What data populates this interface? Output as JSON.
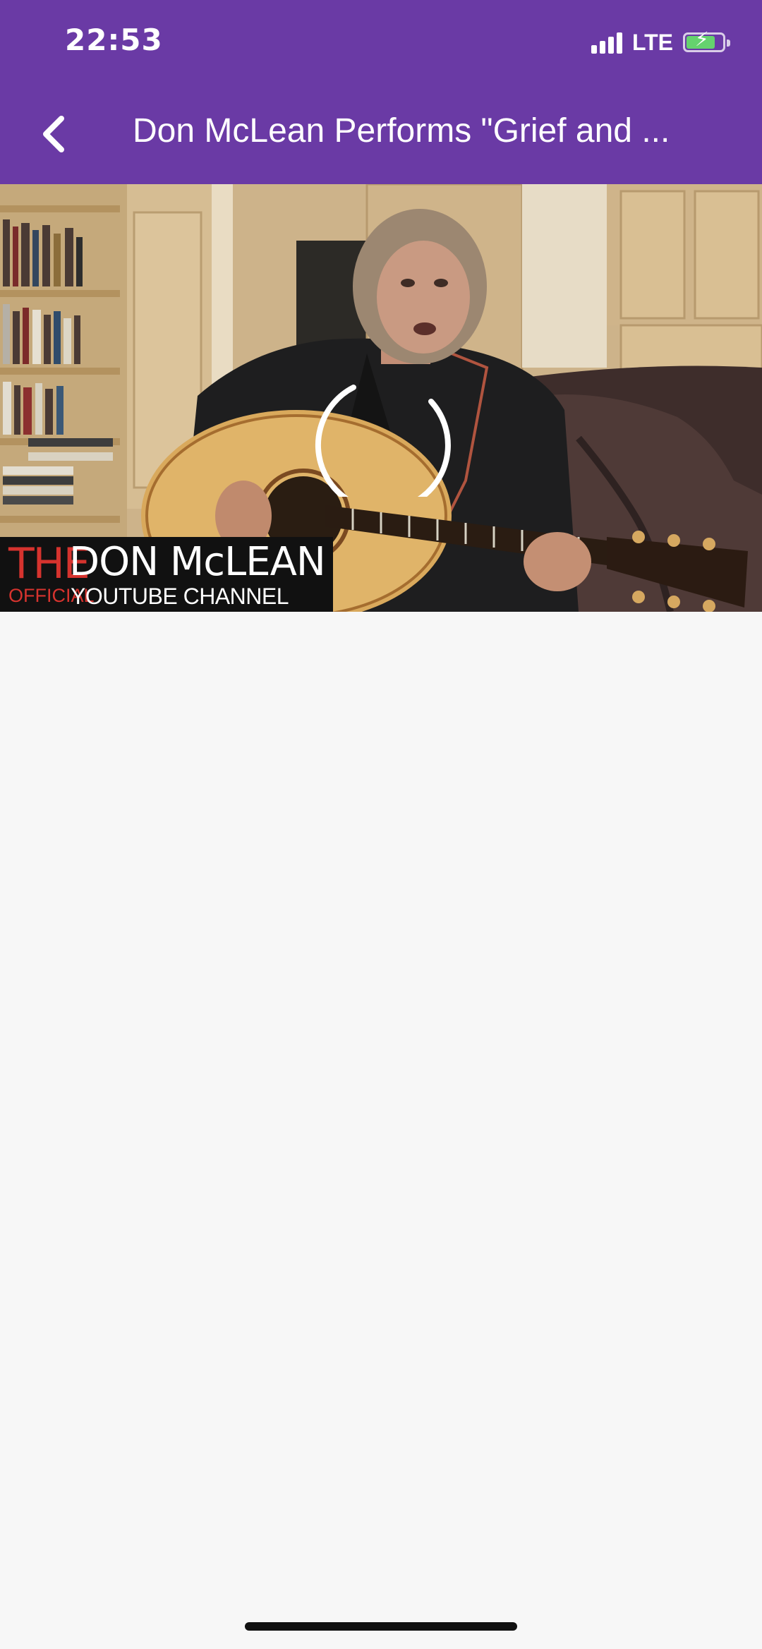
{
  "status_bar": {
    "time": "22:53",
    "network": "LTE",
    "battery_color": "#65d26e"
  },
  "nav": {
    "back_icon": "chevron-left-icon",
    "title": "Don McLean Performs \"Grief and ..."
  },
  "video": {
    "state": "loading",
    "spinner_icon": "loading-spinner-icon",
    "banner": {
      "the": "THE",
      "name": "DON McLEAN",
      "official": "OFFICIAL",
      "channel": "YOUTUBE CHANNEL"
    }
  },
  "colors": {
    "header": "#6a3aa5",
    "background": "#f7f7f7",
    "banner_red": "#d6332e"
  }
}
